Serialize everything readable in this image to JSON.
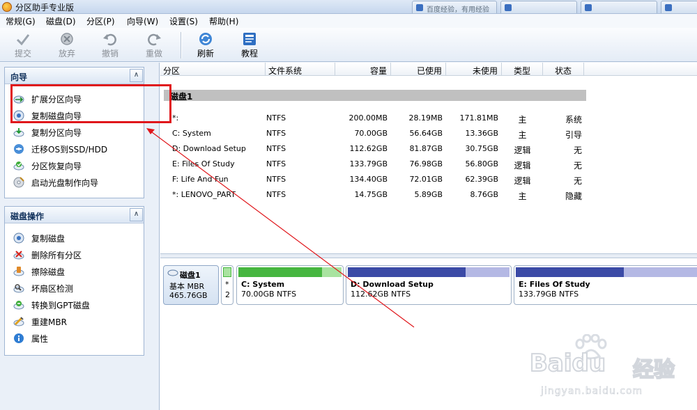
{
  "window": {
    "title": "分区助手专业版",
    "bg_tabs": [
      "百度经验，有用经验"
    ]
  },
  "menu": [
    "常规(G)",
    "磁盘(D)",
    "分区(P)",
    "向导(W)",
    "设置(S)",
    "帮助(H)"
  ],
  "toolbar": [
    {
      "label": "提交",
      "enabled": false,
      "icon": "check-icon"
    },
    {
      "label": "放弃",
      "enabled": false,
      "icon": "discard-icon"
    },
    {
      "label": "撤销",
      "enabled": false,
      "icon": "undo-icon"
    },
    {
      "label": "重做",
      "enabled": false,
      "icon": "redo-icon"
    },
    {
      "label": "刷新",
      "enabled": true,
      "icon": "refresh-icon"
    },
    {
      "label": "教程",
      "enabled": true,
      "icon": "tutorial-icon"
    }
  ],
  "wizard_panel": {
    "title": "向导",
    "items": [
      "扩展分区向导",
      "复制磁盘向导",
      "复制分区向导",
      "迁移OS到SSD/HDD",
      "分区恢复向导",
      "启动光盘制作向导"
    ]
  },
  "disk_ops_panel": {
    "title": "磁盘操作",
    "items": [
      "复制磁盘",
      "删除所有分区",
      "擦除磁盘",
      "坏扇区检测",
      "转换到GPT磁盘",
      "重建MBR",
      "属性"
    ]
  },
  "table": {
    "columns": [
      "分区",
      "文件系统",
      "容量",
      "已使用",
      "未使用",
      "类型",
      "状态"
    ],
    "disk_label": "磁盘1",
    "rows": [
      [
        "*:",
        "NTFS",
        "200.00MB",
        "28.19MB",
        "171.81MB",
        "主",
        "系统"
      ],
      [
        "C: System",
        "NTFS",
        "70.00GB",
        "56.64GB",
        "13.36GB",
        "主",
        "引导"
      ],
      [
        "D: Download Setup",
        "NTFS",
        "112.62GB",
        "81.87GB",
        "30.75GB",
        "逻辑",
        "无"
      ],
      [
        "E: Files Of Study",
        "NTFS",
        "133.79GB",
        "76.98GB",
        "56.80GB",
        "逻辑",
        "无"
      ],
      [
        "F: Life And Fun",
        "NTFS",
        "134.40GB",
        "72.01GB",
        "62.39GB",
        "逻辑",
        "无"
      ],
      [
        "*: LENOVO_PART",
        "NTFS",
        "14.75GB",
        "5.89GB",
        "8.76GB",
        "主",
        "隐藏"
      ]
    ]
  },
  "disk_map": {
    "disk": {
      "name": "磁盘1",
      "type": "基本 MBR",
      "size": "465.76GB"
    },
    "small_part": {
      "line1": "*",
      "line2": "2"
    },
    "partitions": [
      {
        "name": "C: System",
        "info": "70.00GB NTFS",
        "used_fraction": 0.809,
        "color": "#46b640",
        "free_color": "#a9e3a0"
      },
      {
        "name": "D: Download Setup",
        "info": "112.62GB NTFS",
        "used_fraction": 0.727,
        "color": "#3b4aa6",
        "free_color": "#b4b8e4"
      },
      {
        "name": "E: Files Of Study",
        "info": "133.79GB NTFS",
        "used_fraction": 0.575,
        "color": "#3b4aa6",
        "free_color": "#b4b8e4"
      }
    ]
  },
  "watermark": {
    "brand": "Baidu",
    "brand_cn": "经验",
    "url": "jingyan.baidu.com"
  },
  "colors": {
    "highlight_box": "#e0161b",
    "arrow": "#e0161b"
  }
}
